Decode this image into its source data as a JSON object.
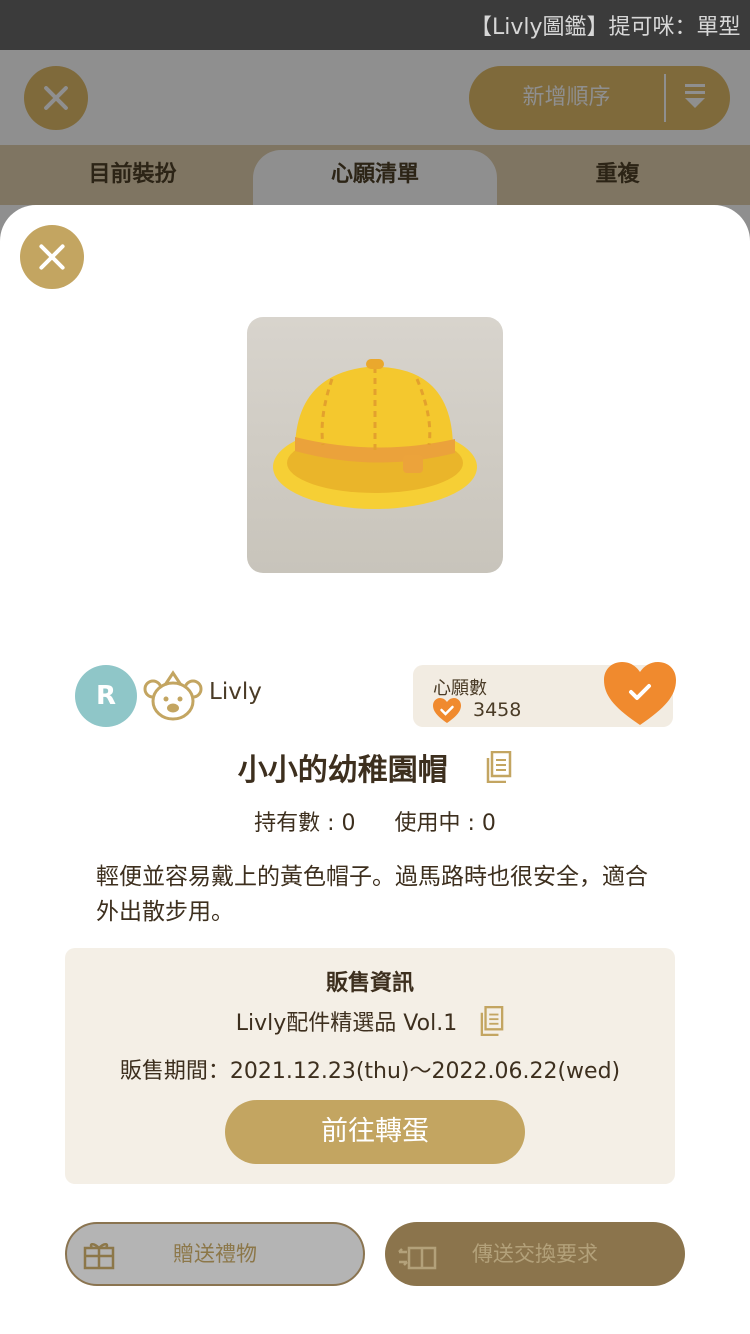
{
  "top_banner": {
    "text": "【Livly圖鑑】提可咪：單型"
  },
  "header": {
    "sort_label": "新增順序"
  },
  "tabs": [
    {
      "label": "目前裝扮"
    },
    {
      "label": "心願清單"
    },
    {
      "label": "重複"
    }
  ],
  "item": {
    "rarity_badge": "R",
    "brand": "Livly",
    "name": "小小的幼稚園帽",
    "wishlist_label": "心願數",
    "wishlist_count": "3458",
    "owned": "持有數 : 0",
    "in_use": "使用中 : 0",
    "description": "輕便並容易戴上的黃色帽子。過馬路時也很安全，適合外出散步用。"
  },
  "sale": {
    "title": "販售資訊",
    "pack": "Livly配件精選品 Vol.1",
    "period": "販售期間：2021.12.23(thu)～2022.06.22(wed)",
    "button": "前往轉蛋"
  },
  "actions": {
    "gift": "贈送禮物",
    "trade": "傳送交換要求"
  },
  "colors": {
    "accent_gold": "#c3a561",
    "heart_orange": "#f08a2e",
    "avatar_teal": "#8fc6c8"
  }
}
